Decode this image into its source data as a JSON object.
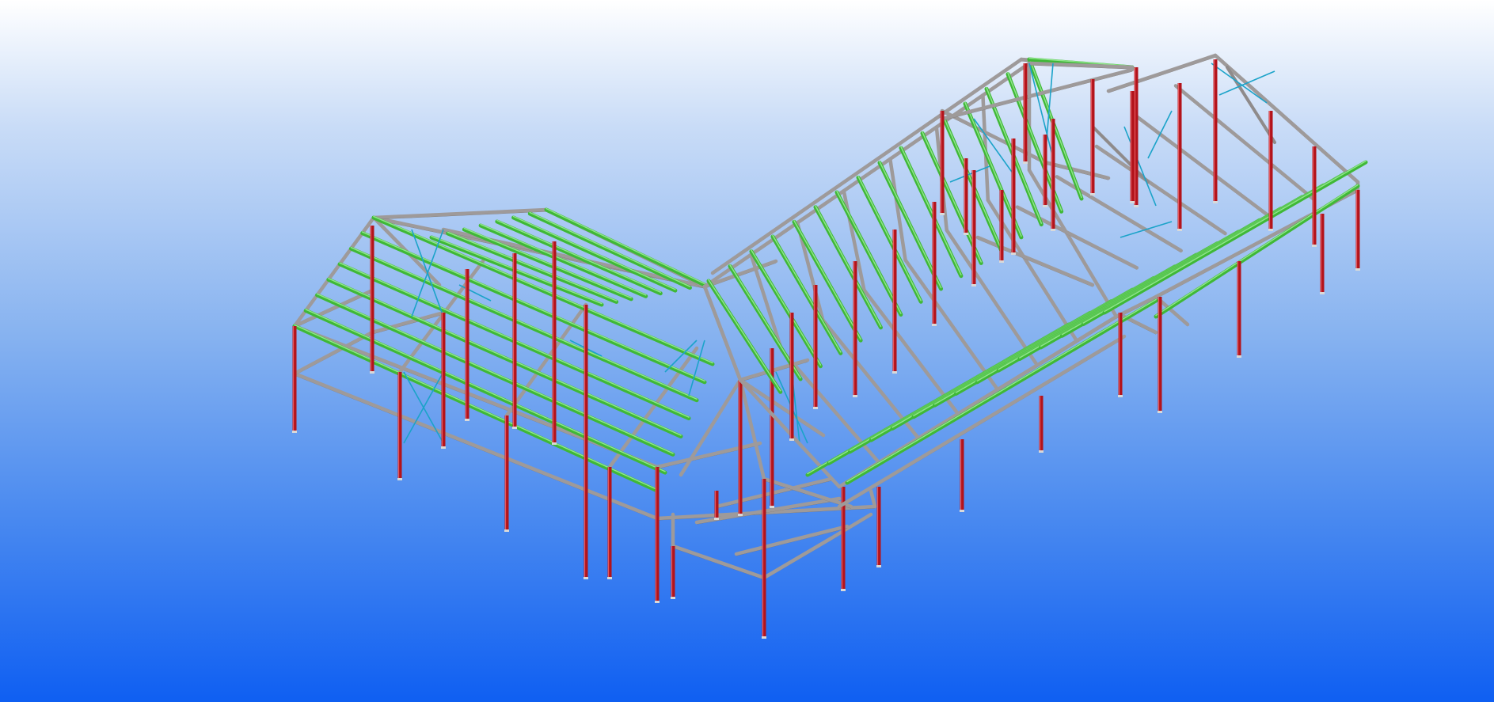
{
  "viewport": {
    "background_top": "#ffffff",
    "background_bottom": "#0f5ff2"
  },
  "model": {
    "colors": {
      "column": "#b3131b",
      "beam": "#9e9a9a",
      "purlin": "#3fb837",
      "bracing": "#1ba3c9"
    }
  }
}
